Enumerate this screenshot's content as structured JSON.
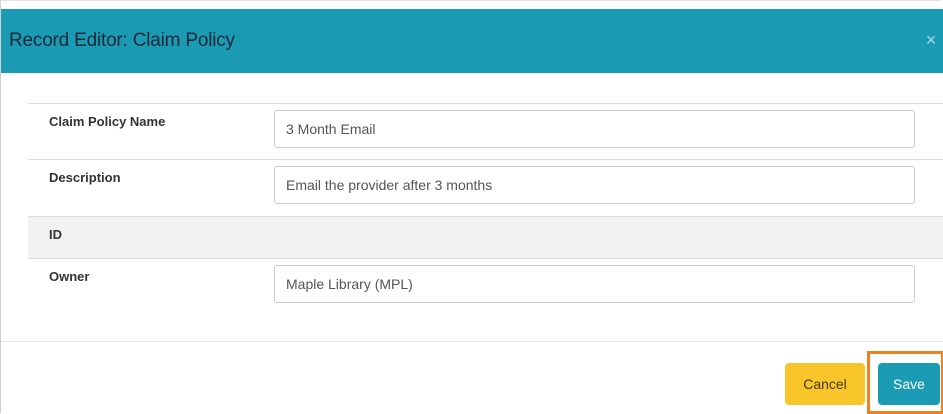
{
  "dialog": {
    "title": "Record Editor: Claim Policy",
    "close_glyph": "×",
    "colors": {
      "header": "#1a9ab3",
      "cancel": "#f8c52a",
      "save": "#1a9ab3",
      "highlight": "#f07f1e"
    }
  },
  "form": {
    "fields": [
      {
        "label": "Claim Policy Name",
        "value": "3 Month Email"
      },
      {
        "label": "Description",
        "value": "Email the provider after 3 months"
      },
      {
        "label": "ID",
        "value": ""
      },
      {
        "label": "Owner",
        "value": "Maple Library (MPL)"
      }
    ]
  },
  "footer": {
    "cancel_label": "Cancel",
    "save_label": "Save"
  }
}
